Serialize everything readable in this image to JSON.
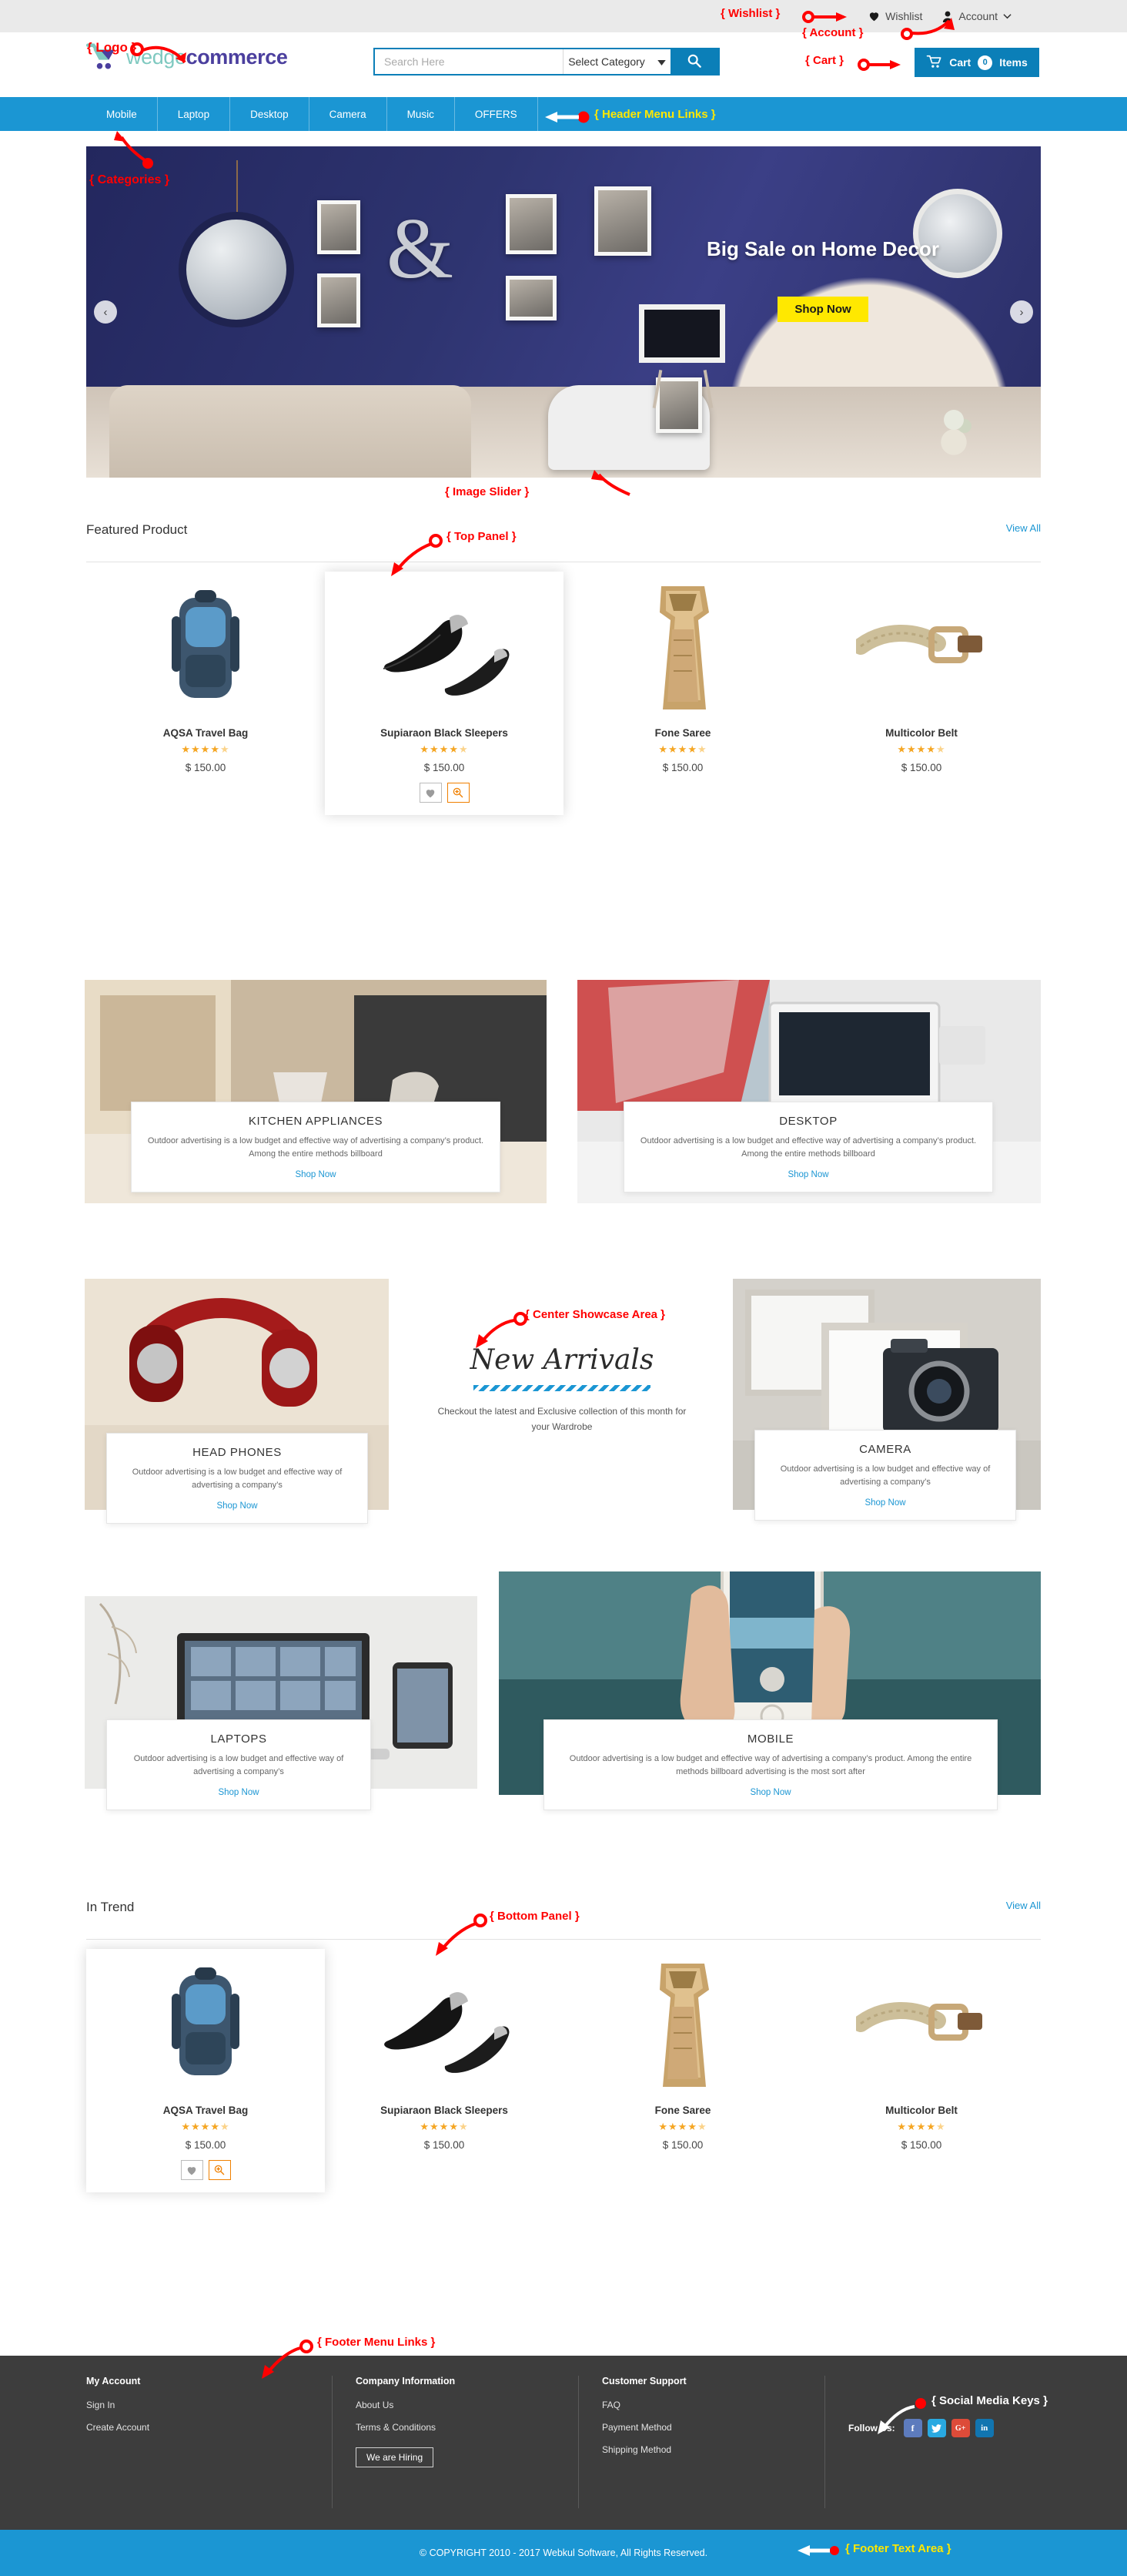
{
  "topbar": {
    "wishlist": "Wishlist",
    "account": "Account",
    "wishlist_icon": "heart-icon",
    "account_icon": "user-icon",
    "chevron_icon": "chevron-down-icon"
  },
  "header": {
    "logo_part1": "wedge",
    "logo_part2": "commerce",
    "search_placeholder": "Search Here",
    "search_value": "",
    "category_label": "Select Category",
    "search_icon": "search-icon",
    "cart_label": "Cart",
    "cart_count": "0",
    "cart_items_label": "Items",
    "cart_icon": "cart-icon"
  },
  "nav": {
    "items": [
      {
        "label": "Mobile"
      },
      {
        "label": "Laptop"
      },
      {
        "label": "Desktop"
      },
      {
        "label": "Camera"
      },
      {
        "label": "Music"
      },
      {
        "label": "OFFERS"
      }
    ]
  },
  "slider": {
    "title": "Big Sale on Home Decor",
    "button": "Shop Now",
    "prev_icon": "chevron-left-icon",
    "next_icon": "chevron-right-icon",
    "prev_glyph": "‹",
    "next_glyph": "›"
  },
  "featured": {
    "title": "Featured Product",
    "view_all": "View All",
    "products": [
      {
        "name": "AQSA Travel Bag",
        "price": "$ 150.00",
        "rating": "4.5",
        "active": false
      },
      {
        "name": "Supiaraon Black Sleepers",
        "price": "$ 150.00",
        "rating": "4.5",
        "active": true
      },
      {
        "name": "Fone Saree",
        "price": "$ 150.00",
        "rating": "4.5",
        "active": false
      },
      {
        "name": "Multicolor Belt",
        "price": "$ 150.00",
        "rating": "4.5",
        "active": false
      }
    ],
    "wishlist_icon": "heart-icon",
    "quickview_icon": "zoom-in-icon"
  },
  "showcase": {
    "kitchen": {
      "title": "KITCHEN APPLIANCES",
      "text": "Outdoor advertising is a low budget and effective way of advertising a company’s product. Among the entire methods billboard",
      "link": "Shop Now"
    },
    "desktop": {
      "title": "DESKTOP",
      "text": "Outdoor advertising is a low budget and effective way of advertising a company’s product. Among the entire methods billboard",
      "link": "Shop Now"
    },
    "headphones": {
      "title": "HEAD PHONES",
      "text": "Outdoor advertising is a low budget and effective way of advertising a company’s",
      "link": "Shop Now"
    },
    "camera": {
      "title": "CAMERA",
      "text": "Outdoor advertising is a low budget and effective way of advertising a company’s",
      "link": "Shop Now"
    },
    "laptops": {
      "title": "LAPTOPS",
      "text": "Outdoor advertising is a low budget and effective way of advertising a company’s",
      "link": "Shop Now"
    },
    "mobile": {
      "title": "MOBILE",
      "text": "Outdoor advertising is a low budget and effective way of advertising a company’s product. Among the entire methods billboard advertising is the most sort after",
      "link": "Shop Now"
    },
    "new_arrivals": {
      "title": "New Arrivals",
      "subtitle": "Checkout the latest and Exclusive collection of this month for your Wardrobe"
    }
  },
  "intrend": {
    "title": "In Trend",
    "view_all": "View All",
    "products": [
      {
        "name": "AQSA Travel Bag",
        "price": "$ 150.00",
        "rating": "4.5",
        "active": true
      },
      {
        "name": "Supiaraon Black Sleepers",
        "price": "$ 150.00",
        "rating": "4.5",
        "active": false
      },
      {
        "name": "Fone Saree",
        "price": "$ 150.00",
        "rating": "4.5",
        "active": false
      },
      {
        "name": "Multicolor Belt",
        "price": "$ 150.00",
        "rating": "4.5",
        "active": false
      }
    ]
  },
  "footer": {
    "columns": [
      {
        "heading": "My Account",
        "links": [
          "Sign In",
          "Create Account"
        ]
      },
      {
        "heading": "Company Information",
        "links": [
          "About Us",
          "Terms & Conditions"
        ],
        "button": "We are Hiring"
      },
      {
        "heading": "Customer Support",
        "links": [
          "FAQ",
          "Payment Method",
          "Shipping Method"
        ]
      }
    ],
    "follow_label": "Follow Us:",
    "social": [
      {
        "name": "facebook-icon",
        "glyph": "f",
        "color": "#5d7bbd"
      },
      {
        "name": "twitter-icon",
        "glyph": "🐦",
        "color": "#29a9e1"
      },
      {
        "name": "google-plus-icon",
        "glyph": "G+",
        "color": "#dd4b39"
      },
      {
        "name": "linkedin-icon",
        "glyph": "in",
        "color": "#1175b0"
      }
    ],
    "copyright": "© COPYRIGHT 2010 - 2017 Webkul Software, All Rights Reserved."
  },
  "annotations": {
    "logo": "{ Logo }",
    "wishlist": "{ Wishlist }",
    "account": "{ Account }",
    "cart": "{ Cart }",
    "header_menu": "{ Header Menu Links }",
    "categories": "{ Categories }",
    "image_slider": "{ Image Slider }",
    "top_panel": "{ Top Panel }",
    "center_showcase": "{ Center Showcase Area }",
    "bottom_panel": "{ Bottom Panel }",
    "footer_menu": "{ Footer Menu Links }",
    "social_media": "{ Social Media Keys }",
    "footer_text": "{ Footer Text Area }"
  },
  "colors": {
    "primary": "#1b96d3",
    "search_blue": "#0b7fb8",
    "accent_yellow": "#ffe800",
    "star": "#f5a623",
    "footer_bg": "#3d3d3d"
  }
}
